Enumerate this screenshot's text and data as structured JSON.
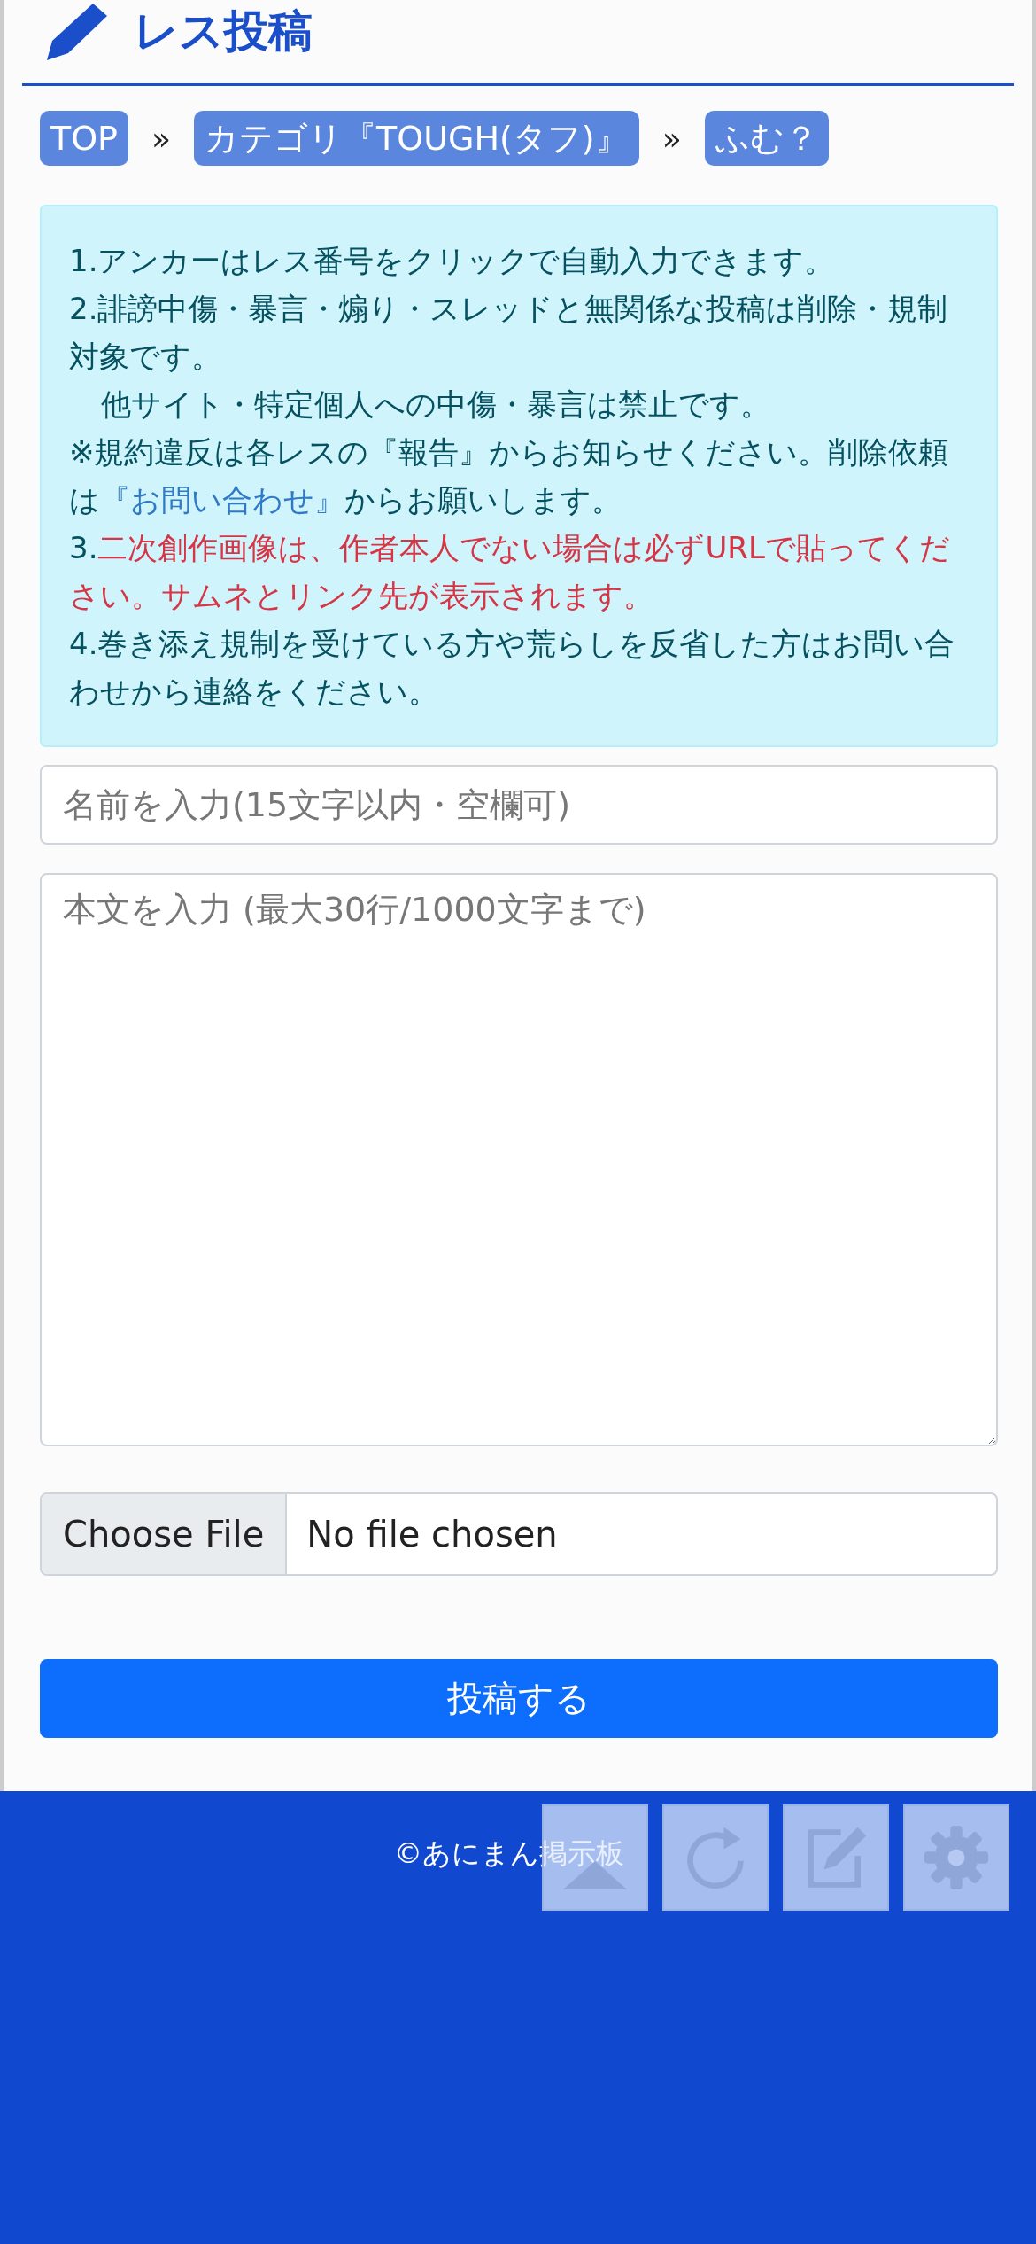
{
  "header": {
    "title": "レス投稿"
  },
  "breadcrumbs": [
    {
      "label": "TOP",
      "separator": "»"
    },
    {
      "label": "カテゴリ『TOUGH(タフ)』",
      "separator": "»"
    },
    {
      "label": "ふむ？"
    }
  ],
  "notice": {
    "paragraphs": [
      [
        {
          "kind": "plain",
          "text": "1.アンカーはレス番号をクリックで自動入力できます。"
        }
      ],
      [
        {
          "kind": "plain",
          "text": "2.誹謗中傷・暴言・煽り・スレッドと無関係な投稿は削除・規制対象です。"
        }
      ],
      [
        {
          "kind": "indent",
          "text": "他サイト・特定個人への中傷・暴言は禁止です。"
        }
      ],
      [
        {
          "kind": "plain",
          "text": "※規約違反は各レスの『報告』からお知らせください。削除依頼は"
        },
        {
          "kind": "link",
          "text": "『お問い合わせ』"
        },
        {
          "kind": "plain",
          "text": "からお願いします。"
        }
      ],
      [
        {
          "kind": "plain",
          "text": "3."
        },
        {
          "kind": "warning",
          "text": "二次創作画像は、作者本人でない場合は必ずURLで貼ってください。サムネとリンク先が表示されます。"
        }
      ],
      [
        {
          "kind": "plain",
          "text": "4.巻き添え規制を受けている方や荒らしを反省した方はお問い合わせから連絡をください。"
        }
      ]
    ]
  },
  "form": {
    "name_placeholder": "名前を入力(15文字以内・空欄可)",
    "body_placeholder": "本文を入力 (最大30行/1000文字まで)",
    "file_button": "Choose File",
    "file_status": "No file chosen",
    "submit": "投稿する"
  },
  "footer": {
    "copyright": "©あにまん掲示板"
  }
}
